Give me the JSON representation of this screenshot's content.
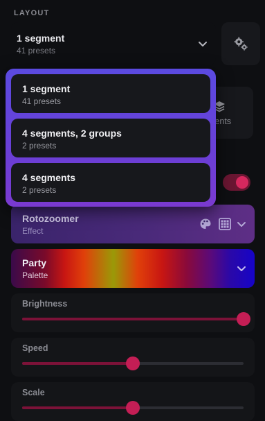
{
  "section": {
    "title": "LAYOUT"
  },
  "layout_select": {
    "title": "1 segment",
    "subtitle": "41 presets",
    "icon": "chevron-down-icon"
  },
  "settings": {
    "icon": "gear-icon"
  },
  "segments_tile": {
    "label": "ments",
    "icon": "layers-icon"
  },
  "toggle": {
    "on": true
  },
  "dropdown": {
    "options": [
      {
        "title": "1 segment",
        "subtitle": "41 presets"
      },
      {
        "title": "4 segments, 2 groups",
        "subtitle": "2 presets"
      },
      {
        "title": "4 segments",
        "subtitle": "2 presets"
      }
    ]
  },
  "effect": {
    "title": "Rotozoomer",
    "subtitle": "Effect",
    "icons": [
      "palette-icon",
      "grid-icon",
      "chevron-down-icon"
    ]
  },
  "palette": {
    "title": "Party",
    "subtitle": "Palette",
    "icon": "chevron-down-icon"
  },
  "sliders": [
    {
      "label": "Brightness",
      "value": 1.0
    },
    {
      "label": "Speed",
      "value": 0.5
    },
    {
      "label": "Scale",
      "value": 0.5
    }
  ],
  "colors": {
    "accent": "#c41e55",
    "dropdown_border": "#6a3fd6"
  }
}
